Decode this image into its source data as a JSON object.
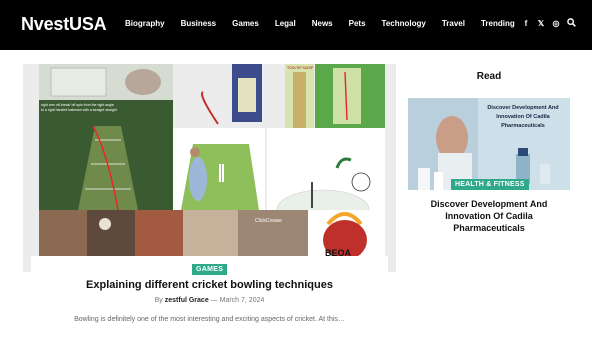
{
  "header": {
    "logo": "NvestUSA",
    "nav": [
      "Biography",
      "Business",
      "Games",
      "Legal",
      "News",
      "Pets",
      "Technology",
      "Travel",
      "Trending"
    ],
    "social_icons": [
      "facebook-icon",
      "x-icon",
      "instagram-icon",
      "search-icon"
    ],
    "social_glyphs": [
      "f",
      "𝕏",
      "◎",
      "⌕"
    ]
  },
  "featured": {
    "category": "GAMES",
    "title": "Explaining different cricket bowling techniques",
    "by": "By",
    "author": "zestful Grace",
    "separator": "—",
    "date": "March 7, 2024",
    "excerpt": "Bowling is definitely one of the most interesting and exciting aspects of cricket. At this…",
    "image_text": {
      "caption_line1": "right arm off-break/ off spin from the right angle",
      "caption_line2": "to a right handed batsman with a straight straight",
      "tooltip": "TOOLTIP SUDIP",
      "bottom_label": "ClickCrease",
      "logo_text": "BEOA"
    }
  },
  "sidebar": {
    "heading": "Read",
    "category": "HEALTH & FITNESS",
    "title": "Discover Development And Innovation Of Cadila Pharmaceuticals",
    "image_caption": "Discover Development And Innovation Of Cadila Pharmaceuticals"
  },
  "colors": {
    "topbar": "#000000",
    "accent": "#2ea98a"
  }
}
